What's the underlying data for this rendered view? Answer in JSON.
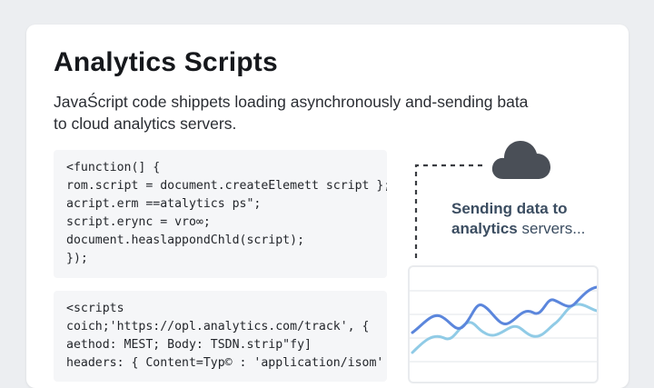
{
  "slide": {
    "title": "Analytics Scripts",
    "subtitle_lines": [
      "JavaŚcript code shippets loading asynchronously and-sending bata",
      "to cloud analytics servers."
    ]
  },
  "code_block_1": {
    "lines": [
      "<function(]  {",
      "  rom.script = document.createElemett script };",
      "  acript.erm ==atalytics ps\";",
      "  script.erync = vro∞;",
      "  document.heaslappondChld(script);",
      "});"
    ]
  },
  "code_block_2": {
    "lines": [
      "<scripts",
      "  coich;'https://opl.analytics.com/track', {",
      "  aethod: MEST; Body: TSDN.strip\"fy]",
      "  headers: { Content=Typ© : 'application/isom' }"
    ]
  },
  "sending": {
    "bold_part_1": "Sending data to",
    "bold_part_2": "analytics",
    "normal_part_2": " servers..."
  },
  "colors": {
    "cloud": "#4a4f57",
    "line_primary": "#5b86dc",
    "line_secondary": "#90cbe6",
    "connector": "#3a3d42"
  },
  "icons": {
    "cloud": "cloud-icon"
  }
}
